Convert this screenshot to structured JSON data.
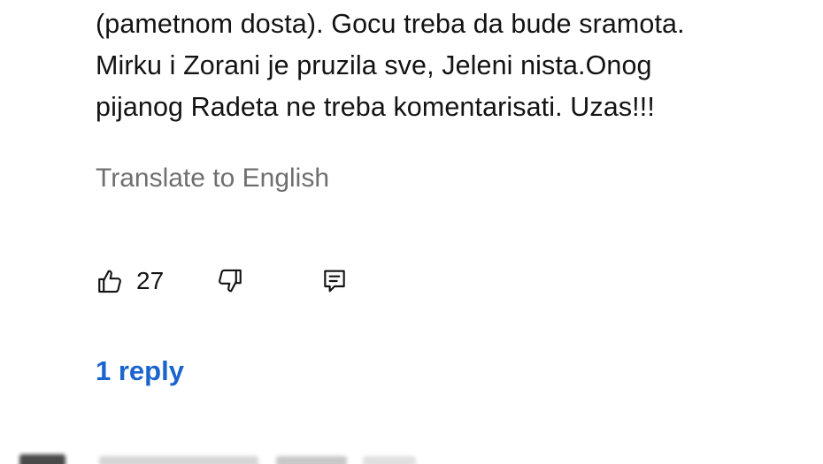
{
  "comment": {
    "text_lines": [
      "(pametnom dosta). Gocu treba da bude sramota.",
      "Mirku i Zorani je pruzila sve, Jeleni nista.Onog",
      "pijanog Radeta ne treba komentarisati. Uzas!!!"
    ],
    "translate_label": "Translate to English",
    "like_count": "27",
    "replies_label": "1 reply"
  },
  "icons": {
    "like": "thumbs-up-icon",
    "dislike": "thumbs-down-icon",
    "reply": "comment-reply-icon"
  },
  "colors": {
    "text": "#131313",
    "muted": "#6f6f6f",
    "link": "#1a64cf"
  }
}
